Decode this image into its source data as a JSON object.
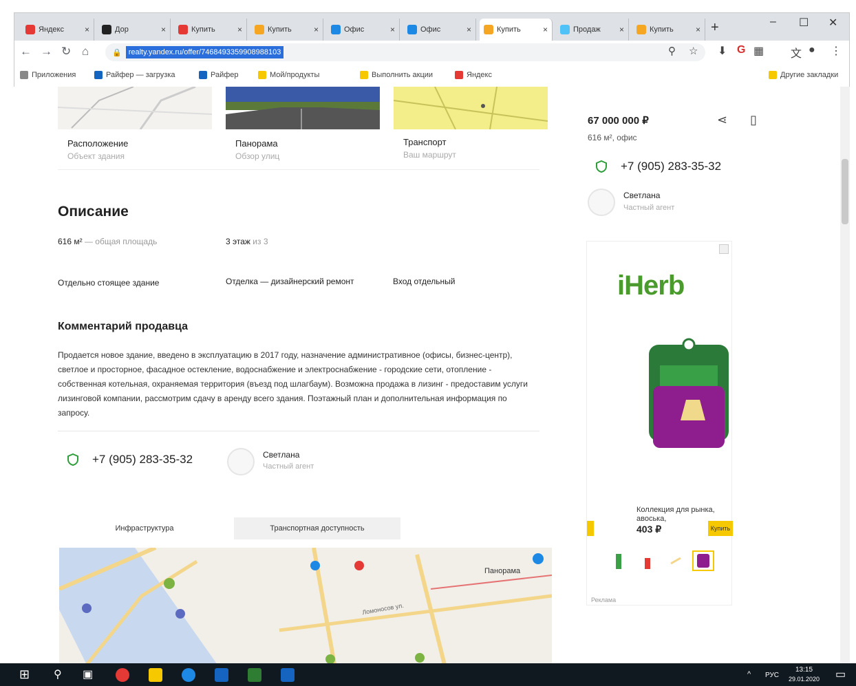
{
  "browser": {
    "tabs": [
      {
        "label": "Яндекс",
        "color": "#e53935",
        "active": false
      },
      {
        "label": "Дор",
        "color": "#222222",
        "active": false
      },
      {
        "label": "Купить",
        "color": "#e53935",
        "active": false
      },
      {
        "label": "Купить",
        "color": "#f5a623",
        "active": false
      },
      {
        "label": "Офис",
        "color": "#1e88e5",
        "active": false
      },
      {
        "label": "Офис",
        "color": "#1e88e5",
        "active": false
      },
      {
        "label": "Купить",
        "color": "#f5a623",
        "active": true
      },
      {
        "label": "Продаж",
        "color": "#4fc3f7",
        "active": false
      },
      {
        "label": "Купить",
        "color": "#f5a623",
        "active": false
      }
    ],
    "url": "realty.yandex.ru/offer/7468493359908988103",
    "bookmarks": [
      {
        "label": "Приложения",
        "color": "#888888"
      },
      {
        "label": "Райфер — загрузка",
        "color": "#1565c0"
      },
      {
        "label": "Райфер",
        "color": "#1565c0"
      },
      {
        "label": "Мой/продукты",
        "color": "#f5c800"
      },
      {
        "label": "Выполнить акции",
        "color": "#f5c800"
      },
      {
        "label": "Яндекс",
        "color": "#e53935"
      },
      {
        "label": "Другие закладки",
        "color": "#f5c800"
      }
    ]
  },
  "listing": {
    "thumbs": [
      {
        "label": "Расположение",
        "sub": "Объект здания"
      },
      {
        "label": "Панорама",
        "sub": "Обзор улиц"
      },
      {
        "label": "Транспорт",
        "sub": "Ваш маршрут"
      }
    ],
    "description_title": "Описание",
    "props": {
      "area_value": "616 м²",
      "area_label": "— общая площадь",
      "floor_value": "3 этаж",
      "floor_label": "из 3",
      "building": "Отдельно стоящее здание",
      "finish": "Отделка — дизайнерский ремонт",
      "entrance": "Вход отдельный"
    },
    "comment_title": "Комментарий продавца",
    "comment_text": "Продается новое здание, введено в эксплуатацию в 2017 году, назначение административное (офисы, бизнес-центр), светлое и просторное, фасадное остекление, водоснабжение и электроснабжение - городские сети, отопление - собственная котельная, охраняемая территория (въезд под шлагбаум). Возможна продажа в лизинг - предоставим услуги лизинговой компании, рассмотрим сдачу в аренду всего здания. Поэтажный план и дополнительная информация по запросу.",
    "phone": "+7 (905) 283-35-32",
    "agent_name": "Светлана",
    "agent_type": "Частный агент",
    "map_tabs": [
      "Инфраструктура",
      "Транспортная доступность"
    ],
    "map_labels": [
      "Панорама",
      "Ломоносов ул."
    ]
  },
  "sidebar": {
    "price": "67 000 000 ₽",
    "area": "616 м², офис",
    "phone": "+7 (905) 283-35-32",
    "agent_name": "Светлана",
    "agent_type": "Частный агент"
  },
  "ad": {
    "brand": "iHerb",
    "product": "Коллекция для рынка, авоська,",
    "price": "403 ₽",
    "button": "Купить",
    "foot": "Реклама"
  },
  "taskbar": {
    "lang": "РУС",
    "time": "13:15",
    "date": "29.01.2020"
  }
}
